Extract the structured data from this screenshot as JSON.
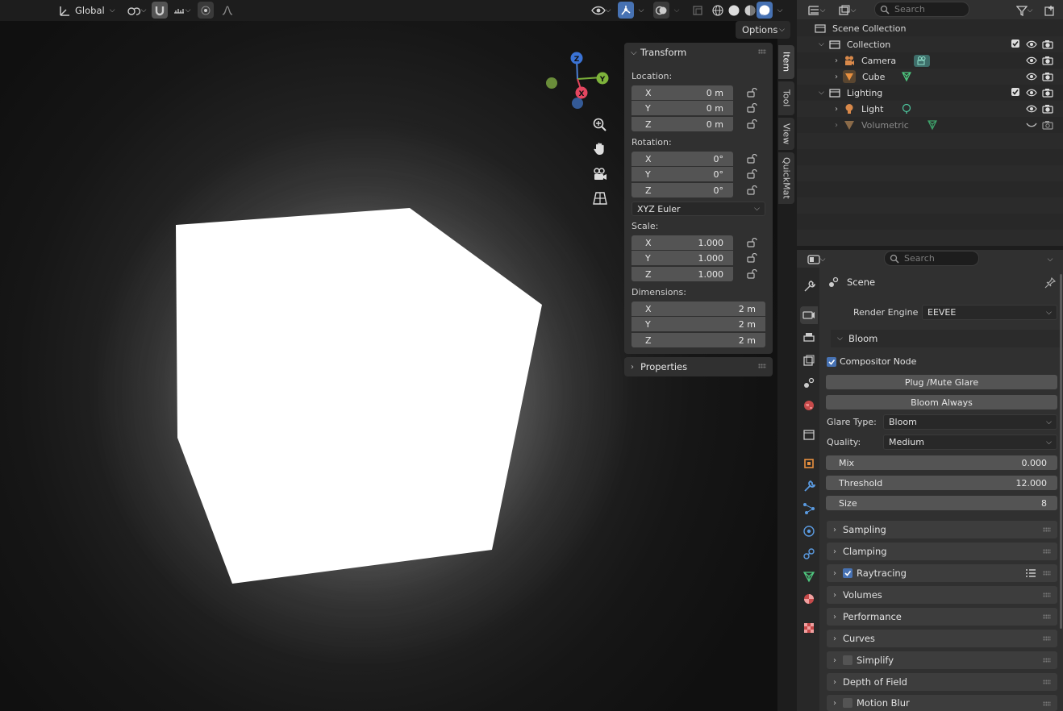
{
  "viewport": {
    "header": {
      "orientation": "Global",
      "options_label": "Options"
    },
    "gizmo": {
      "z": "Z",
      "y": "Y",
      "x": "X"
    }
  },
  "npanel": {
    "transform_title": "Transform",
    "location_label": "Location:",
    "location": [
      {
        "axis": "X",
        "value": "0 m"
      },
      {
        "axis": "Y",
        "value": "0 m"
      },
      {
        "axis": "Z",
        "value": "0 m"
      }
    ],
    "rotation_label": "Rotation:",
    "rotation": [
      {
        "axis": "X",
        "value": "0°"
      },
      {
        "axis": "Y",
        "value": "0°"
      },
      {
        "axis": "Z",
        "value": "0°"
      }
    ],
    "rotation_mode": "XYZ Euler",
    "scale_label": "Scale:",
    "scale": [
      {
        "axis": "X",
        "value": "1.000"
      },
      {
        "axis": "Y",
        "value": "1.000"
      },
      {
        "axis": "Z",
        "value": "1.000"
      }
    ],
    "dimensions_label": "Dimensions:",
    "dimensions": [
      {
        "axis": "X",
        "value": "2 m"
      },
      {
        "axis": "Y",
        "value": "2 m"
      },
      {
        "axis": "Z",
        "value": "2 m"
      }
    ],
    "properties_title": "Properties",
    "tabs": [
      "Item",
      "Tool",
      "View",
      "QuickMat"
    ]
  },
  "outliner": {
    "search_placeholder": "Search",
    "scene_collection": "Scene Collection",
    "rows": [
      {
        "name": "Collection"
      },
      {
        "name": "Camera"
      },
      {
        "name": "Cube"
      },
      {
        "name": "Lighting"
      },
      {
        "name": "Light"
      },
      {
        "name": "Volumetric"
      }
    ]
  },
  "properties": {
    "search_placeholder": "Search",
    "context": "Scene",
    "render_engine_label": "Render Engine",
    "render_engine": "EEVEE",
    "bloom_panel": "Bloom",
    "compositor_node": "Compositor Node",
    "plug_mute": "Plug /Mute Glare",
    "bloom_always": "Bloom Always",
    "glare_type_label": "Glare Type:",
    "glare_type": "Bloom",
    "quality_label": "Quality:",
    "quality": "Medium",
    "sliders": [
      {
        "label": "Mix",
        "value": "0.000"
      },
      {
        "label": "Threshold",
        "value": "12.000"
      },
      {
        "label": "Size",
        "value": "8"
      }
    ],
    "panels": [
      "Sampling",
      "Clamping",
      "Raytracing",
      "Volumes",
      "Performance",
      "Curves",
      "Simplify",
      "Depth of Field",
      "Motion Blur"
    ]
  }
}
